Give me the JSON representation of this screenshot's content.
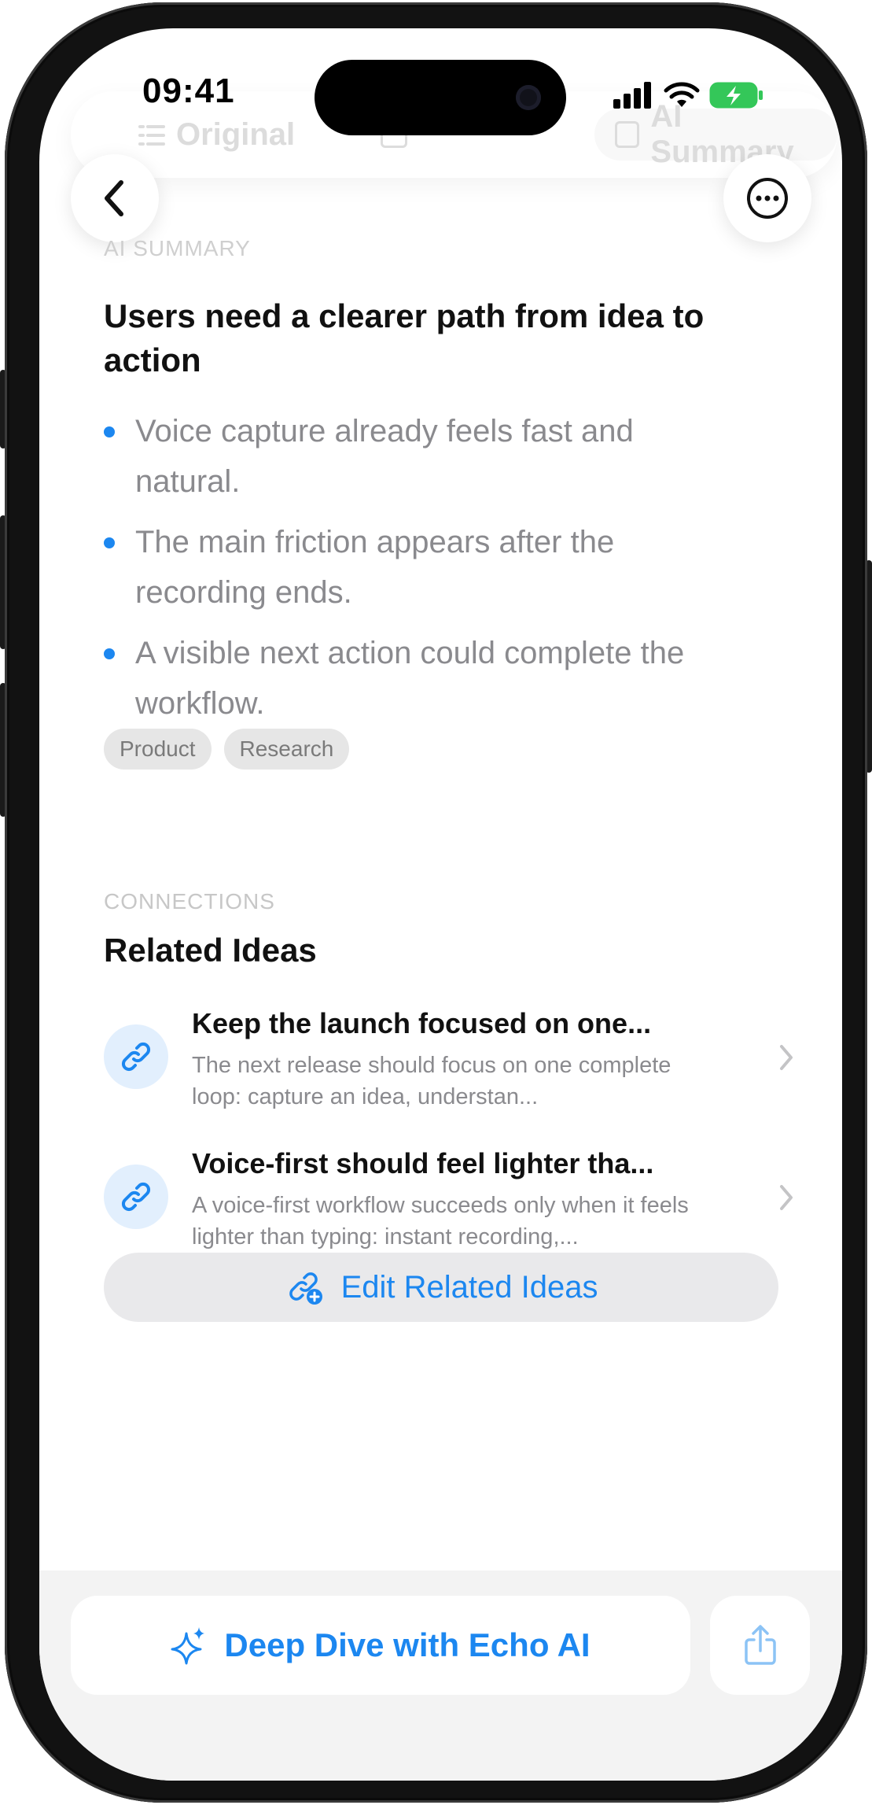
{
  "status_bar": {
    "time": "09:41"
  },
  "tabs": [
    {
      "label": "Original",
      "icon": "list-icon"
    },
    {
      "label": "",
      "icon": "organize-icon"
    },
    {
      "label": "AI Summary",
      "icon": "summary-icon"
    }
  ],
  "summary": {
    "section_label": "AI SUMMARY",
    "title": "Users need a clearer path from idea to action",
    "bullets": [
      "Voice capture already feels fast and natural.",
      "The main friction appears after the recording ends.",
      "A visible next action could complete the workflow."
    ],
    "tags": [
      "Product",
      "Research"
    ]
  },
  "connections": {
    "section_label": "CONNECTIONS",
    "title": "Related Ideas",
    "items": [
      {
        "title": "Keep the launch focused on one...",
        "description": "The next release should focus on one complete loop: capture an idea, understan..."
      },
      {
        "title": "Voice-first should feel lighter tha...",
        "description": "A voice-first workflow succeeds only when it feels lighter than typing: instant recording,..."
      }
    ],
    "edit_label": "Edit Related Ideas"
  },
  "bottom": {
    "deep_dive_label": "Deep Dive with Echo AI"
  },
  "colors": {
    "accent": "#1c87f0",
    "battery": "#34c759",
    "secondary_text": "#8a8a8e"
  }
}
